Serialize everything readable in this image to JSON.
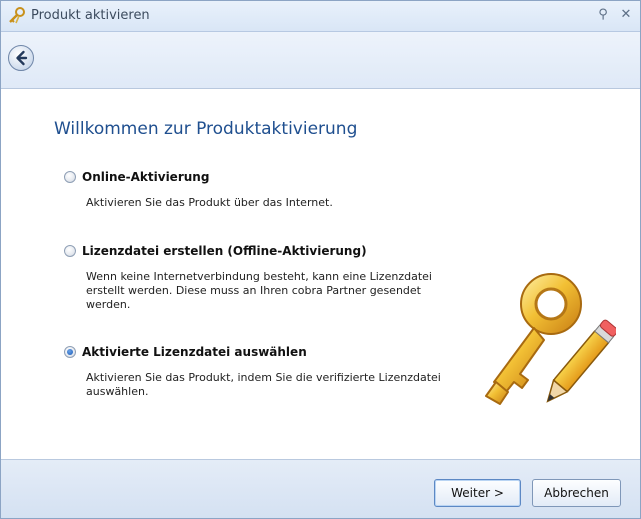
{
  "window": {
    "title": "Produkt aktivieren",
    "pin_glyph": "⚲",
    "close_glyph": "✕"
  },
  "toolbar": {
    "back_icon": "back-arrow-icon"
  },
  "main": {
    "heading": "Willkommen zur Produktaktivierung",
    "options": [
      {
        "label": "Online-Aktivierung",
        "description": "Aktivieren Sie das Produkt über das Internet.",
        "checked": false
      },
      {
        "label": "Lizenzdatei erstellen (Offline-Aktivierung)",
        "description": "Wenn keine Internetverbindung besteht, kann eine Lizenzdatei erstellt werden. Diese muss an Ihren cobra Partner gesendet werden.",
        "checked": false
      },
      {
        "label": "Aktivierte Lizenzdatei auswählen",
        "description": "Aktivieren Sie das Produkt, indem Sie die verifizierte Lizenzdatei auswählen.",
        "checked": true
      }
    ],
    "hero_icon": "key-and-pencil-icon"
  },
  "footer": {
    "next_label": "Weiter >",
    "cancel_label": "Abbrechen"
  },
  "colors": {
    "heading": "#1f4f8f",
    "titlebar": "#dfe9f7",
    "accent": "#1a5bb8"
  }
}
